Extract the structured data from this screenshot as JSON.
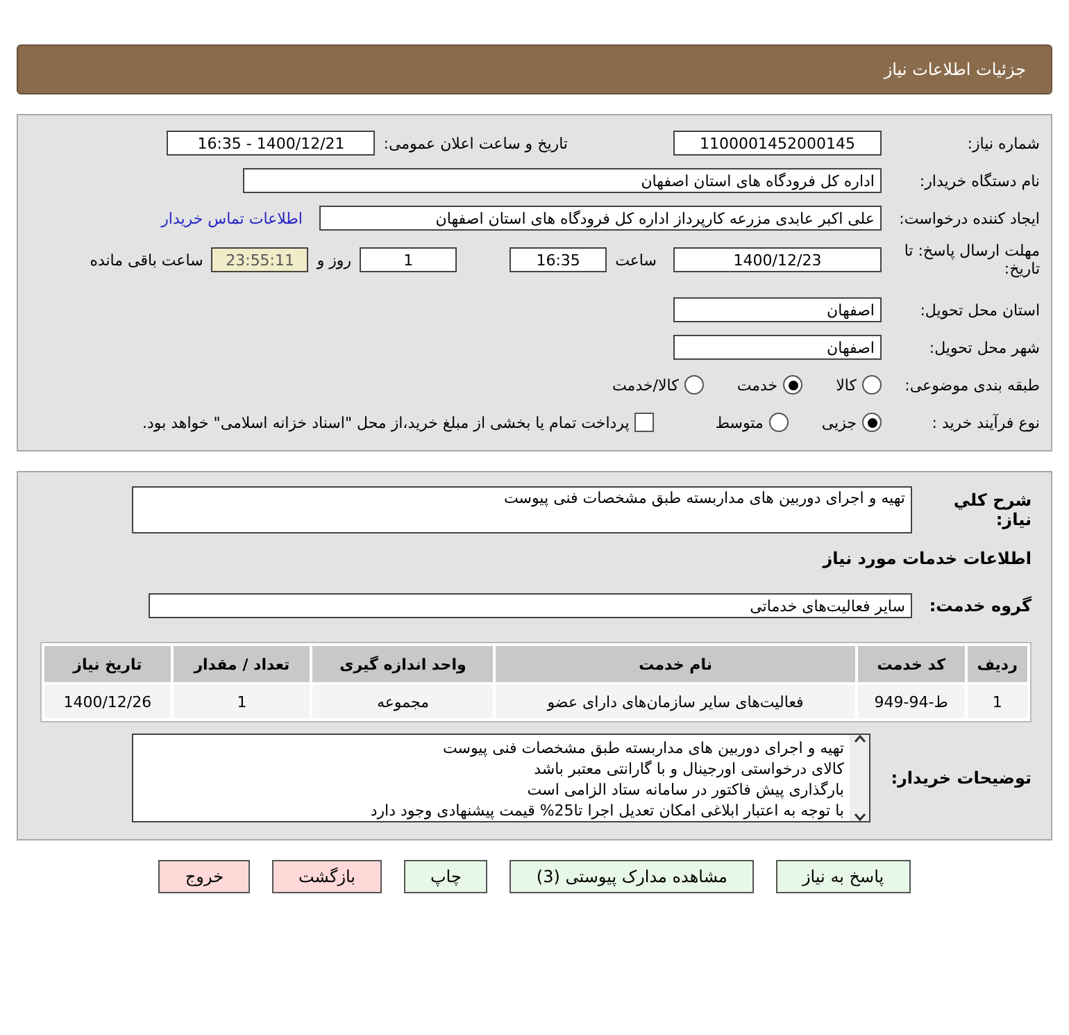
{
  "header": {
    "title": "جزئیات اطلاعات نیاز"
  },
  "need_number": {
    "label": "شماره نیاز:",
    "value": "1100001452000145"
  },
  "announce": {
    "label": "تاریخ و ساعت اعلان عمومی:",
    "value": "1400/12/21 - 16:35"
  },
  "buyer_org": {
    "label": "نام دستگاه خریدار:",
    "value": "اداره کل فرودگاه های استان اصفهان"
  },
  "requester": {
    "label": "ایجاد کننده درخواست:",
    "value": "علی اکبر عابدی مزرعه کارپرداز اداره کل فرودگاه های استان اصفهان",
    "link": "اطلاعات تماس خریدار"
  },
  "deadline": {
    "label": "مهلت ارسال پاسخ: تا تاریخ:",
    "date": "1400/12/23",
    "time_label": "ساعت",
    "time": "16:35",
    "days": "1",
    "days_label": "روز و",
    "remaining": "23:55:11",
    "remaining_label": "ساعت باقی مانده"
  },
  "province": {
    "label": "استان محل تحویل:",
    "value": "اصفهان"
  },
  "city": {
    "label": "شهر محل تحویل:",
    "value": "اصفهان"
  },
  "category": {
    "label": "طبقه بندی موضوعی:",
    "options": [
      {
        "label": "کالا",
        "selected": false
      },
      {
        "label": "خدمت",
        "selected": true
      },
      {
        "label": "کالا/خدمت",
        "selected": false
      }
    ]
  },
  "purchase_type": {
    "label": "نوع فرآیند خرید :",
    "options": [
      {
        "label": "جزیی",
        "selected": true
      },
      {
        "label": "متوسط",
        "selected": false
      }
    ],
    "payment": {
      "label": "پرداخت تمام یا بخشی از مبلغ خرید،از محل \"اسناد خزانه اسلامی\" خواهد بود.",
      "checked": false
    }
  },
  "description": {
    "label": "شرح کلي نياز:",
    "value": "تهیه و اجرای دوربین های مداربسته  طبق مشخصات فنی پیوست"
  },
  "services_title": "اطلاعات خدمات مورد نیاز",
  "service_group": {
    "label": "گروه خدمت:",
    "value": "سایر فعالیت‌های خدماتی"
  },
  "table": {
    "columns": [
      "ردیف",
      "کد خدمت",
      "نام خدمت",
      "واحد اندازه گیری",
      "تعداد / مقدار",
      "تاریخ نیاز"
    ],
    "rows": [
      [
        "1",
        "ط-94-949",
        "فعالیت‌های سایر سازمان‌های دارای عضو",
        "مجموعه",
        "1",
        "1400/12/26"
      ]
    ]
  },
  "buyer_notes": {
    "label": "توضیحات خریدار:",
    "lines": [
      "تهیه و اجرای دوربین های مداربسته  طبق مشخصات فنی پیوست",
      " کالای درخواستی اورجینال و با گارانتی معتبر باشد",
      "بارگذاری پیش فاکتور در سامانه ستاد الزامی است",
      "با توجه به اعتبار ابلاغی امکان تعدیل اجرا تا25% قیمت پیشنهادی وجود دارد"
    ]
  },
  "buttons": [
    {
      "label": "پاسخ به نیاز",
      "kind": "primary"
    },
    {
      "label": "مشاهده مدارک پیوستی (3)",
      "kind": "primary"
    },
    {
      "label": "چاپ",
      "kind": "primary"
    },
    {
      "label": "بازگشت",
      "kind": "danger"
    },
    {
      "label": "خروج",
      "kind": "danger"
    }
  ]
}
